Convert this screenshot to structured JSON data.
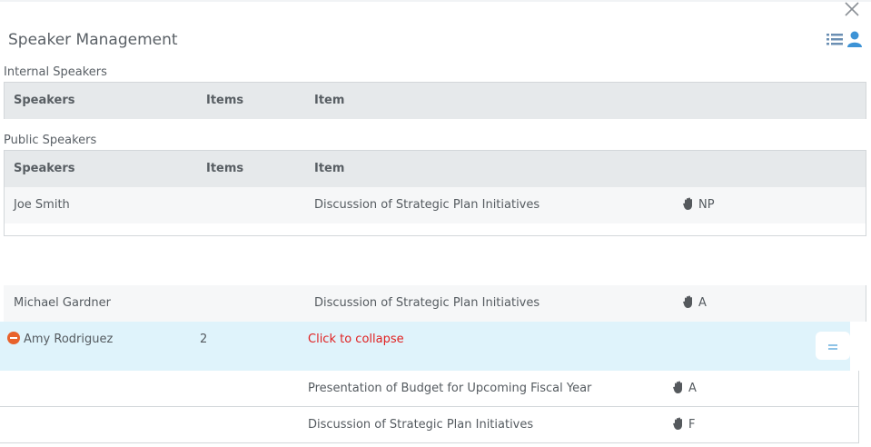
{
  "window": {
    "title": "Speaker Management",
    "close_icon": "close-icon",
    "view_toggle_icons": [
      "list-icon",
      "person-icon"
    ]
  },
  "internal": {
    "label": "Internal Speakers",
    "headers": {
      "speakers": "Speakers",
      "items": "Items",
      "item": "Item"
    }
  },
  "public": {
    "label": "Public Speakers",
    "headers": {
      "speakers": "Speakers",
      "items": "Items",
      "item": "Item"
    },
    "rows": [
      {
        "name": "Joe Smith",
        "items": "",
        "item": "Discussion of Strategic Plan Initiatives",
        "status": "NP"
      }
    ]
  },
  "list": {
    "rows": [
      {
        "name": "Michael Gardner",
        "items": "",
        "item": "Discussion of Strategic Plan Initiatives",
        "status": "A"
      }
    ],
    "expanded": {
      "name": "Amy Rodriguez",
      "items": "2",
      "action": "Click to collapse",
      "sub_rows": [
        {
          "item": "Presentation of Budget for Upcoming Fiscal Year",
          "status": "A"
        },
        {
          "item": "Discussion of Strategic Plan Initiatives",
          "status": "F"
        }
      ]
    }
  },
  "colors": {
    "accent": "#1f8dd6",
    "collapse": "#e02020",
    "minus": "#e8622c",
    "expanded_bg": "#dff3fb"
  }
}
